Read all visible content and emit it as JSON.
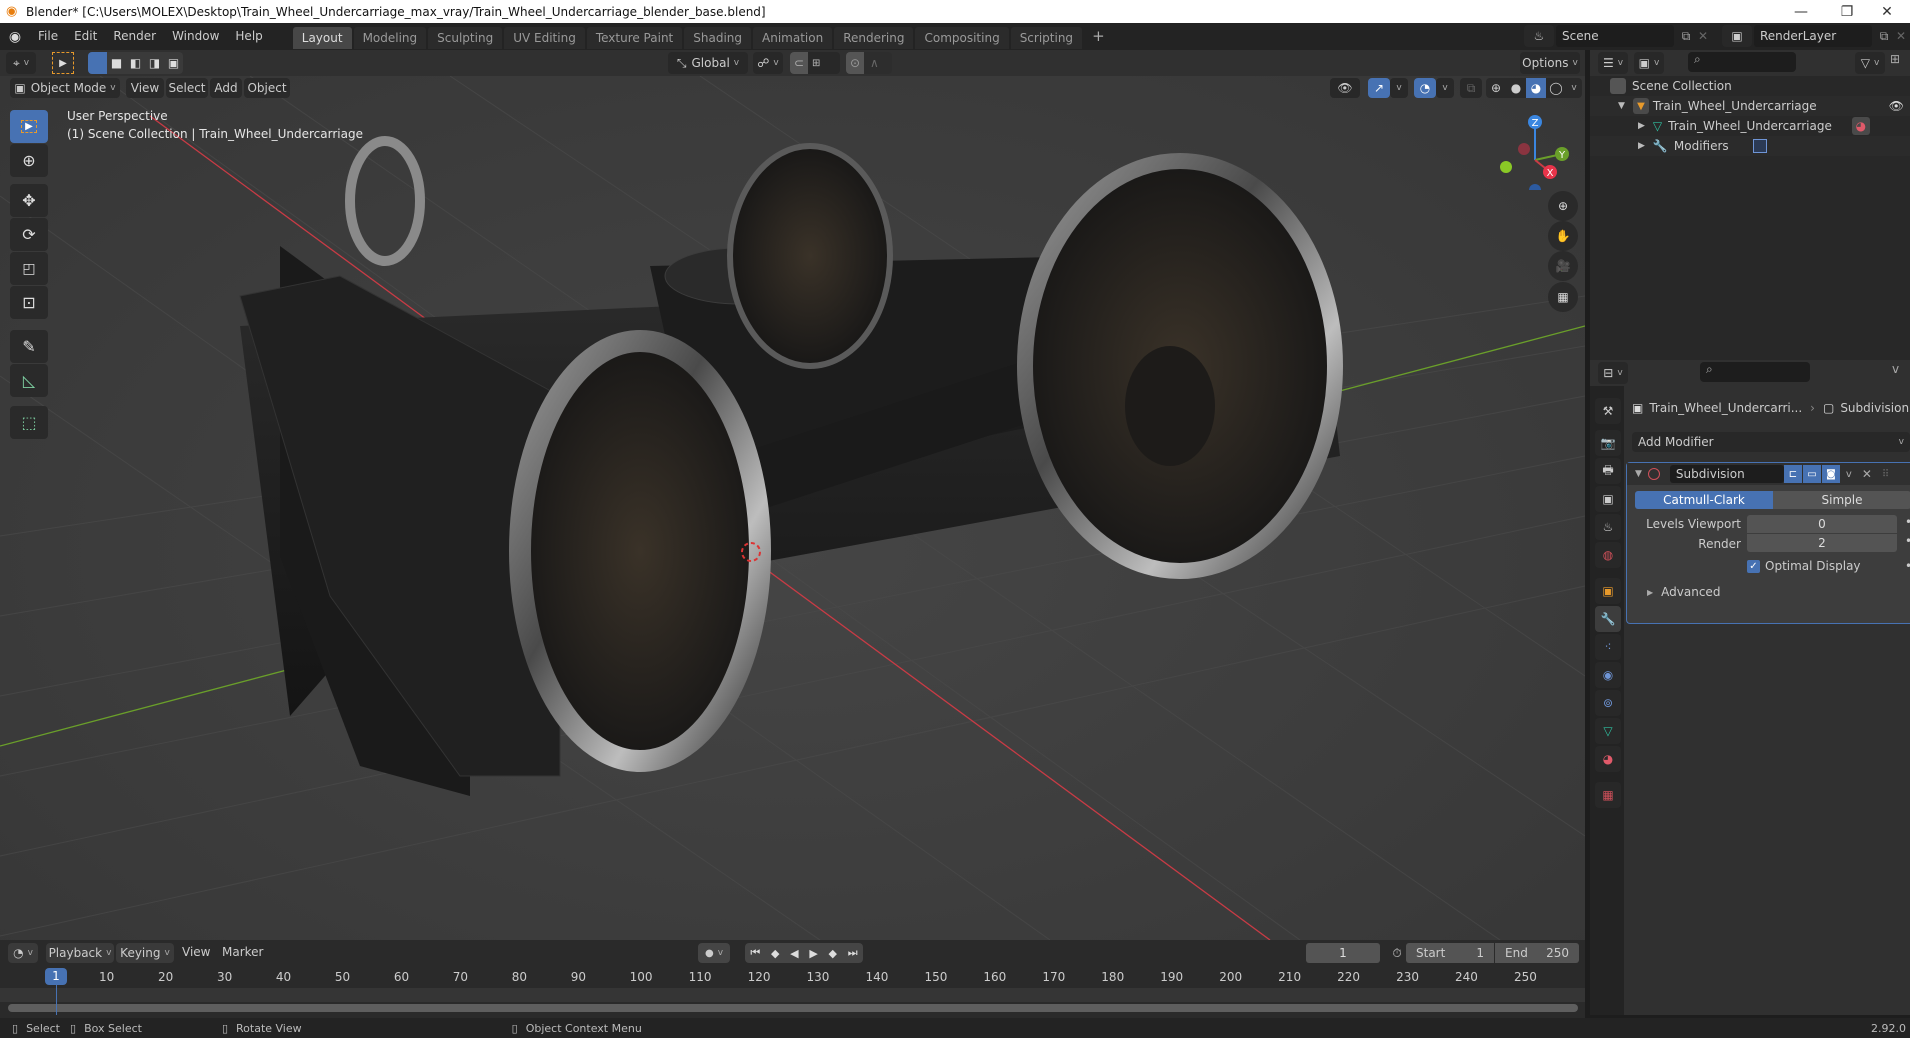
{
  "titlebar": {
    "title": "Blender* [C:\\Users\\MOLEX\\Desktop\\Train_Wheel_Undercarriage_max_vray/Train_Wheel_Undercarriage_blender_base.blend]",
    "minimize": "—",
    "maximize": "❐",
    "close": "✕"
  },
  "menubar": {
    "menus": [
      "File",
      "Edit",
      "Render",
      "Window",
      "Help"
    ],
    "workspaces": [
      "Layout",
      "Modeling",
      "Sculpting",
      "UV Editing",
      "Texture Paint",
      "Shading",
      "Animation",
      "Rendering",
      "Compositing",
      "Scripting"
    ],
    "active_workspace": "Layout",
    "add_workspace": "+",
    "scene": "Scene",
    "render_layer": "RenderLayer"
  },
  "tool_header": {
    "orientation": "Global",
    "options": "Options"
  },
  "viewport_header": {
    "mode": "Object Mode",
    "menus": [
      "View",
      "Select",
      "Add",
      "Object"
    ]
  },
  "viewport": {
    "perspective": "User Perspective",
    "collection_info": "(1) Scene Collection | Train_Wheel_Undercarriage",
    "gizmo": {
      "z": "Z",
      "y": "Y",
      "x": "X"
    },
    "colors": {
      "x_axis": "#c83b45",
      "y_axis": "#6a9f2a",
      "z_axis": "#3a86e0",
      "grid": "#505050"
    }
  },
  "toolbar": {
    "tools": [
      "select-box",
      "cursor",
      "move",
      "rotate",
      "scale",
      "transform",
      "annotate",
      "measure",
      "add-cube"
    ]
  },
  "outliner": {
    "root": "Scene Collection",
    "items": [
      {
        "label": "Train_Wheel_Undercarriage",
        "type": "object",
        "level": 1
      },
      {
        "label": "Train_Wheel_Undercarriage",
        "type": "mesh",
        "level": 2
      },
      {
        "label": "Modifiers",
        "type": "modifiers",
        "level": 2
      }
    ]
  },
  "properties": {
    "breadcrumb_object": "Train_Wheel_Undercarri...",
    "breadcrumb_modifier": "Subdivision",
    "add_modifier": "Add Modifier",
    "modifier": {
      "name": "Subdivision",
      "types": [
        "Catmull-Clark",
        "Simple"
      ],
      "active_type": "Catmull-Clark",
      "levels_viewport_label": "Levels Viewport",
      "levels_viewport": "0",
      "render_label": "Render",
      "render": "2",
      "optimal_display_label": "Optimal Display",
      "optimal_display": true,
      "advanced_label": "Advanced"
    }
  },
  "timeline": {
    "menus": [
      "Playback",
      "Keying",
      "View",
      "Marker"
    ],
    "current_frame": "1",
    "start_label": "Start",
    "start": "1",
    "end_label": "End",
    "end": "250",
    "ticks": [
      "10",
      "20",
      "30",
      "40",
      "50",
      "60",
      "70",
      "80",
      "90",
      "100",
      "110",
      "120",
      "130",
      "140",
      "150",
      "160",
      "170",
      "180",
      "190",
      "200",
      "210",
      "220",
      "230",
      "240",
      "250"
    ],
    "playhead": "1"
  },
  "statusbar": {
    "select": "Select",
    "box_select": "Box Select",
    "rotate_view": "Rotate View",
    "context_menu": "Object Context Menu",
    "version": "2.92.0"
  }
}
